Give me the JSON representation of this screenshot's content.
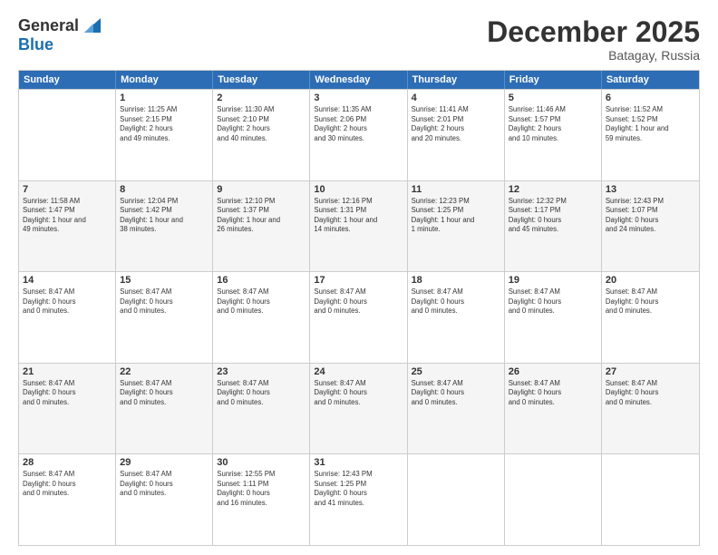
{
  "logo": {
    "general": "General",
    "blue": "Blue"
  },
  "title": "December 2025",
  "location": "Batagay, Russia",
  "days_of_week": [
    "Sunday",
    "Monday",
    "Tuesday",
    "Wednesday",
    "Thursday",
    "Friday",
    "Saturday"
  ],
  "weeks": [
    [
      {
        "day": "",
        "info": ""
      },
      {
        "day": "1",
        "info": "Sunrise: 11:25 AM\nSunset: 2:15 PM\nDaylight: 2 hours\nand 49 minutes."
      },
      {
        "day": "2",
        "info": "Sunrise: 11:30 AM\nSunset: 2:10 PM\nDaylight: 2 hours\nand 40 minutes."
      },
      {
        "day": "3",
        "info": "Sunrise: 11:35 AM\nSunset: 2:06 PM\nDaylight: 2 hours\nand 30 minutes."
      },
      {
        "day": "4",
        "info": "Sunrise: 11:41 AM\nSunset: 2:01 PM\nDaylight: 2 hours\nand 20 minutes."
      },
      {
        "day": "5",
        "info": "Sunrise: 11:46 AM\nSunset: 1:57 PM\nDaylight: 2 hours\nand 10 minutes."
      },
      {
        "day": "6",
        "info": "Sunrise: 11:52 AM\nSunset: 1:52 PM\nDaylight: 1 hour and\n59 minutes."
      }
    ],
    [
      {
        "day": "7",
        "info": "Sunrise: 11:58 AM\nSunset: 1:47 PM\nDaylight: 1 hour and\n49 minutes."
      },
      {
        "day": "8",
        "info": "Sunrise: 12:04 PM\nSunset: 1:42 PM\nDaylight: 1 hour and\n38 minutes."
      },
      {
        "day": "9",
        "info": "Sunrise: 12:10 PM\nSunset: 1:37 PM\nDaylight: 1 hour and\n26 minutes."
      },
      {
        "day": "10",
        "info": "Sunrise: 12:16 PM\nSunset: 1:31 PM\nDaylight: 1 hour and\n14 minutes."
      },
      {
        "day": "11",
        "info": "Sunrise: 12:23 PM\nSunset: 1:25 PM\nDaylight: 1 hour and\n1 minute."
      },
      {
        "day": "12",
        "info": "Sunrise: 12:32 PM\nSunset: 1:17 PM\nDaylight: 0 hours\nand 45 minutes."
      },
      {
        "day": "13",
        "info": "Sunrise: 12:43 PM\nSunset: 1:07 PM\nDaylight: 0 hours\nand 24 minutes."
      }
    ],
    [
      {
        "day": "14",
        "info": "Sunset: 8:47 AM\nDaylight: 0 hours\nand 0 minutes."
      },
      {
        "day": "15",
        "info": "Sunset: 8:47 AM\nDaylight: 0 hours\nand 0 minutes."
      },
      {
        "day": "16",
        "info": "Sunset: 8:47 AM\nDaylight: 0 hours\nand 0 minutes."
      },
      {
        "day": "17",
        "info": "Sunset: 8:47 AM\nDaylight: 0 hours\nand 0 minutes."
      },
      {
        "day": "18",
        "info": "Sunset: 8:47 AM\nDaylight: 0 hours\nand 0 minutes."
      },
      {
        "day": "19",
        "info": "Sunset: 8:47 AM\nDaylight: 0 hours\nand 0 minutes."
      },
      {
        "day": "20",
        "info": "Sunset: 8:47 AM\nDaylight: 0 hours\nand 0 minutes."
      }
    ],
    [
      {
        "day": "21",
        "info": "Sunset: 8:47 AM\nDaylight: 0 hours\nand 0 minutes."
      },
      {
        "day": "22",
        "info": "Sunset: 8:47 AM\nDaylight: 0 hours\nand 0 minutes."
      },
      {
        "day": "23",
        "info": "Sunset: 8:47 AM\nDaylight: 0 hours\nand 0 minutes."
      },
      {
        "day": "24",
        "info": "Sunset: 8:47 AM\nDaylight: 0 hours\nand 0 minutes."
      },
      {
        "day": "25",
        "info": "Sunset: 8:47 AM\nDaylight: 0 hours\nand 0 minutes."
      },
      {
        "day": "26",
        "info": "Sunset: 8:47 AM\nDaylight: 0 hours\nand 0 minutes."
      },
      {
        "day": "27",
        "info": "Sunset: 8:47 AM\nDaylight: 0 hours\nand 0 minutes."
      }
    ],
    [
      {
        "day": "28",
        "info": "Sunset: 8:47 AM\nDaylight: 0 hours\nand 0 minutes."
      },
      {
        "day": "29",
        "info": "Sunset: 8:47 AM\nDaylight: 0 hours\nand 0 minutes."
      },
      {
        "day": "30",
        "info": "Sunrise: 12:55 PM\nSunset: 1:11 PM\nDaylight: 0 hours\nand 16 minutes."
      },
      {
        "day": "31",
        "info": "Sunrise: 12:43 PM\nSunset: 1:25 PM\nDaylight: 0 hours\nand 41 minutes."
      },
      {
        "day": "",
        "info": ""
      },
      {
        "day": "",
        "info": ""
      },
      {
        "day": "",
        "info": ""
      }
    ]
  ]
}
